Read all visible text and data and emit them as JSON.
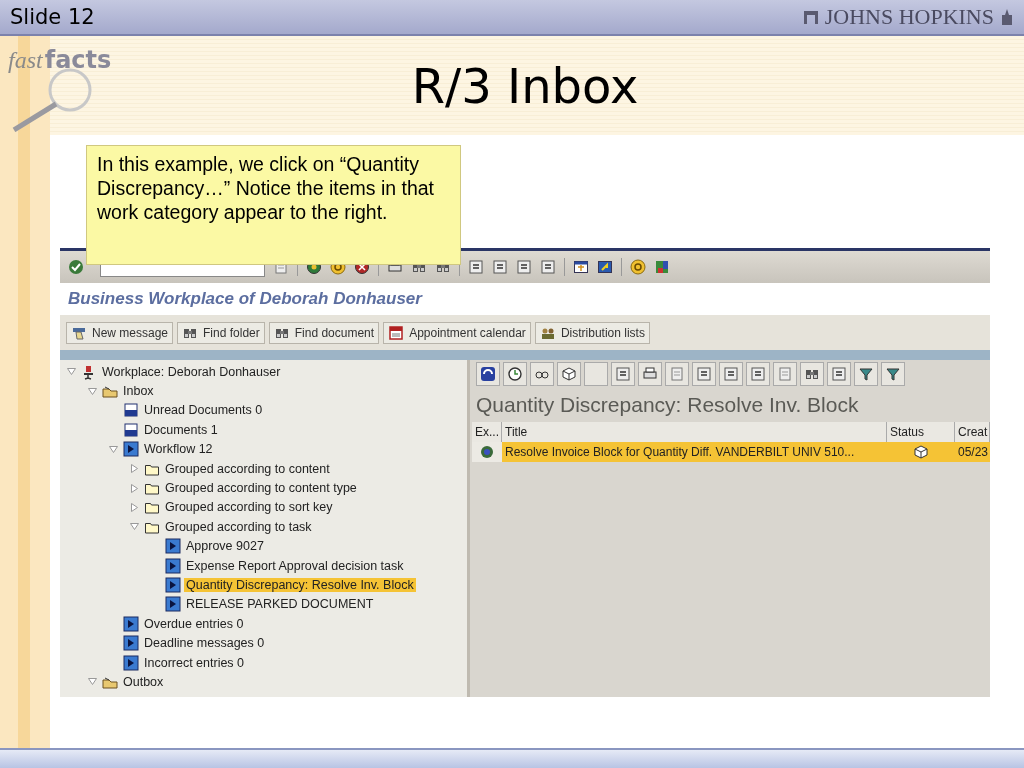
{
  "slide": {
    "number": "Slide 12",
    "brand": "JOHNS HOPKINS",
    "logo": [
      "fast",
      "facts"
    ],
    "title": "R/3 Inbox",
    "note": "In this example, we click on “Quantity Discrepancy…” Notice the items in that work category appear to the right."
  },
  "sap": {
    "screen_title": "Business Workplace of Deborah Donhauser",
    "app_buttons": [
      {
        "label": "New message",
        "kind": "message"
      },
      {
        "label": "Find folder",
        "kind": "binoculars"
      },
      {
        "label": "Find document",
        "kind": "binoculars"
      },
      {
        "label": "Appointment calendar",
        "kind": "calendar"
      },
      {
        "label": "Distribution lists",
        "kind": "people"
      }
    ],
    "tree": [
      {
        "label": "Workplace: Deborah Donhauser",
        "kind": "workplace",
        "expanded": true,
        "children": [
          {
            "label": "Inbox",
            "kind": "tray",
            "expanded": true,
            "children": [
              {
                "label": "Unread Documents 0",
                "kind": "documents"
              },
              {
                "label": "Documents 1",
                "kind": "documents"
              },
              {
                "label": "Workflow 12",
                "kind": "workflow",
                "expanded": true,
                "children": [
                  {
                    "label": "Grouped according to content",
                    "kind": "folder",
                    "expanded": false
                  },
                  {
                    "label": "Grouped according to content type",
                    "kind": "folder",
                    "expanded": false
                  },
                  {
                    "label": "Grouped according to sort key",
                    "kind": "folder",
                    "expanded": false
                  },
                  {
                    "label": "Grouped according to task",
                    "kind": "folder",
                    "expanded": true,
                    "children": [
                      {
                        "label": "Approve 9027",
                        "kind": "task",
                        "selected": false
                      },
                      {
                        "label": "Expense Report Approval decision task",
                        "kind": "task",
                        "selected": false
                      },
                      {
                        "label": "Quantity Discrepancy: Resolve Inv. Block",
                        "kind": "task",
                        "selected": true
                      },
                      {
                        "label": "RELEASE PARKED DOCUMENT",
                        "kind": "task",
                        "selected": false
                      }
                    ]
                  }
                ]
              },
              {
                "label": "Overdue entries 0",
                "kind": "workflow"
              },
              {
                "label": "Deadline messages 0",
                "kind": "workflow"
              },
              {
                "label": "Incorrect entries 0",
                "kind": "workflow"
              }
            ]
          },
          {
            "label": "Outbox",
            "kind": "tray",
            "expanded": true
          }
        ]
      }
    ],
    "list_title": "Quantity Discrepancy: Resolve Inv. Block",
    "columns": [
      "Ex...",
      "Title",
      "Status",
      "Creat"
    ],
    "rows": [
      {
        "title": "Resolve Invoice Block for Quantity Diff. VANDERBILT UNIV 510...",
        "date": "05/23",
        "selected": true
      }
    ]
  }
}
